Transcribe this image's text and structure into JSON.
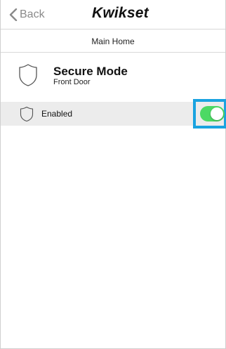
{
  "nav": {
    "back_label": "Back",
    "brand": "Kwikset"
  },
  "location": {
    "name": "Main Home"
  },
  "device": {
    "title": "Secure Mode",
    "subtitle": "Front Door"
  },
  "setting": {
    "label": "Enabled",
    "toggle_on": true,
    "toggle_color": "#4cd964"
  },
  "colors": {
    "highlight": "#1aa3e0",
    "row_background": "#ececec",
    "back_text": "#8a8a8a"
  },
  "icons": {
    "back": "chevron-left-icon",
    "device": "shield-icon",
    "setting": "shield-icon"
  }
}
